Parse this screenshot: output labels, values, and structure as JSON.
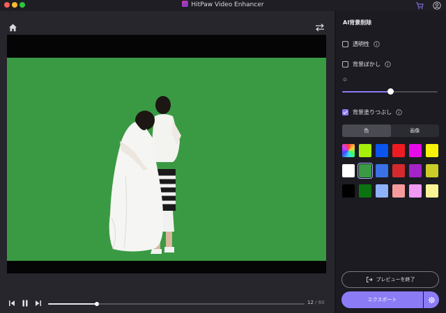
{
  "app": {
    "title": "HitPaw Video Enhancer"
  },
  "player": {
    "current_frame": "12",
    "total_frames": "/ 60",
    "progress": 0.19
  },
  "panel": {
    "title": "AI背景削除",
    "options": {
      "transparency": {
        "label": "透明性",
        "checked": false
      },
      "blur": {
        "label": "背景ぼかし",
        "checked": false,
        "level_label": "中",
        "level": 0.51
      },
      "fill": {
        "label": "背景塗りつぶし",
        "checked": true
      }
    },
    "tabs": [
      {
        "label": "色",
        "active": true
      },
      {
        "label": "画像",
        "active": false
      }
    ],
    "colors": [
      [
        "rainbow",
        "#a5ef0b",
        "#0a55ee",
        "#ee1b23",
        "#e70be9",
        "#f6f20b"
      ],
      [
        "#ffffff",
        "#3a9a43",
        "#3a72e6",
        "#d42a2e",
        "#a523c8",
        "#cbcb2a"
      ],
      [
        "#000000",
        "#0b7410",
        "#8fb3fb",
        "#f79a9c",
        "#f09af3",
        "#f9f395"
      ]
    ],
    "selected_color": "#3a9a43",
    "preview_button": "プレビューを終了",
    "export_button": "エクスポート"
  },
  "colors": {
    "accent": "#8b7cf6",
    "background_fill": "#3a9a43"
  }
}
